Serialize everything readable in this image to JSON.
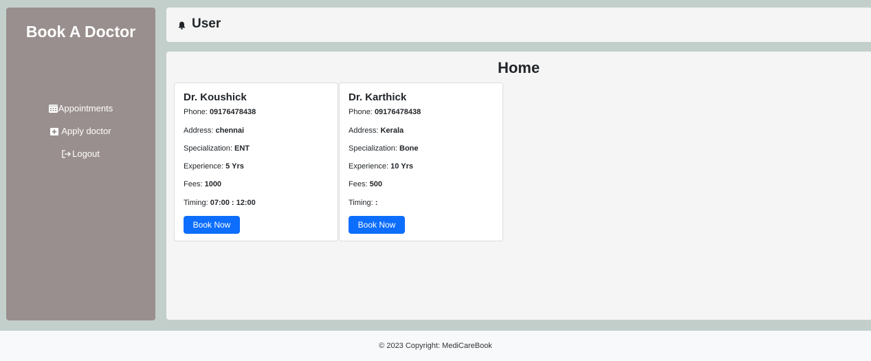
{
  "sidebar": {
    "brand": "Book A Doctor",
    "items": [
      {
        "label": "Appointments",
        "icon": "calendar-icon"
      },
      {
        "label": "Apply doctor",
        "icon": "medical-plus-icon"
      },
      {
        "label": "Logout",
        "icon": "logout-icon"
      }
    ]
  },
  "header": {
    "title": "User",
    "icon": "bell-icon"
  },
  "main": {
    "title": "Home",
    "doctors": [
      {
        "name": "Dr. Koushick",
        "phone_label": "Phone:",
        "phone": "09176478438",
        "address_label": "Address:",
        "address": "chennai",
        "specialization_label": "Specialization:",
        "specialization": "ENT",
        "experience_label": "Experience:",
        "experience": "5 Yrs",
        "fees_label": "Fees:",
        "fees": "1000",
        "timing_label": "Timing:",
        "timing": "07:00 : 12:00",
        "button": "Book Now"
      },
      {
        "name": "Dr. Karthick",
        "phone_label": "Phone:",
        "phone": "09176478438",
        "address_label": "Address:",
        "address": "Kerala",
        "specialization_label": "Specialization:",
        "specialization": "Bone",
        "experience_label": "Experience:",
        "experience": "10 Yrs",
        "fees_label": "Fees:",
        "fees": "500",
        "timing_label": "Timing:",
        "timing": ":",
        "button": "Book Now"
      }
    ]
  },
  "footer": {
    "text": "© 2023 Copyright: MediCareBook"
  },
  "colors": {
    "sidebar_bg": "#998f8e",
    "shell_bg": "#c3cfcb",
    "primary_button": "#0d6efd"
  }
}
